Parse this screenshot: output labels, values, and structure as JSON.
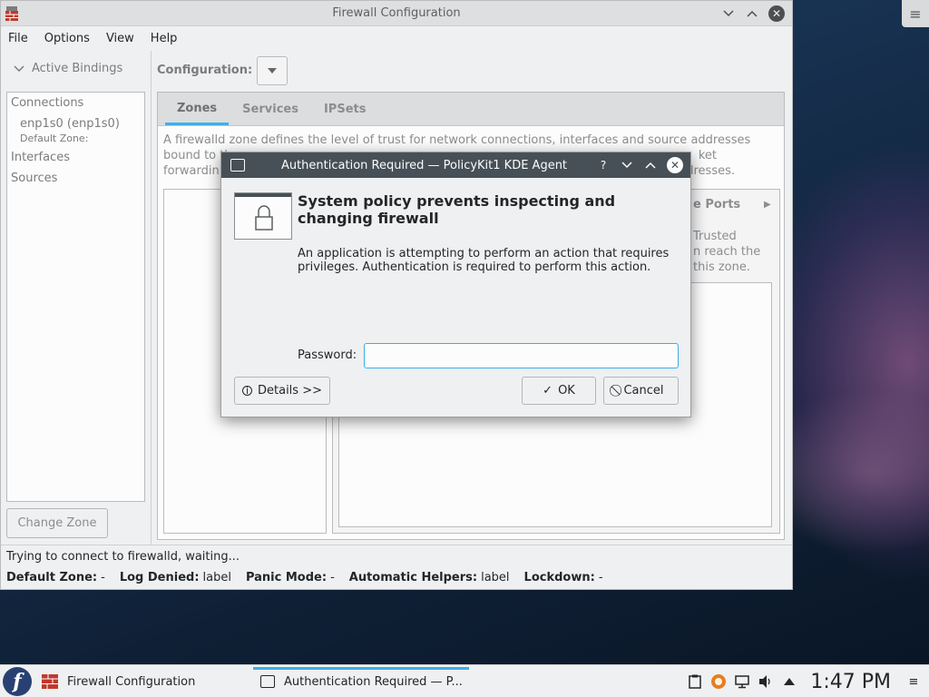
{
  "main_window": {
    "title": "Firewall Configuration",
    "menu": [
      "File",
      "Options",
      "View",
      "Help"
    ],
    "left": {
      "active_bindings": "Active Bindings",
      "connections": "Connections",
      "connection_item": "enp1s0 (enp1s0)",
      "default_zone": "Default Zone:",
      "interfaces": "Interfaces",
      "sources": "Sources",
      "change_zone": "Change Zone"
    },
    "right": {
      "configuration_label": "Configuration:",
      "tabs": [
        "Zones",
        "Services",
        "IPSets"
      ],
      "zone_desc_l1": "A firewalld zone defines the level of trust for network connections, interfaces and source addresses",
      "zone_desc_l2a": "bound to th",
      "zone_desc_l2b": "ket",
      "zone_desc_l3a": "forwardin",
      "zone_desc_l3b": "ddresses.",
      "subtab_partial": "e Ports",
      "trusted_l1": "Trusted",
      "trusted_l2": "n reach the",
      "trusted_l3": "this zone."
    },
    "status": {
      "message": "Trying to connect to firewalld, waiting...",
      "default_zone_label": "Default Zone:",
      "default_zone_value": "-",
      "log_denied_label": "Log Denied:",
      "log_denied_value": "label",
      "panic_mode_label": "Panic Mode:",
      "panic_mode_value": "-",
      "auto_helpers_label": "Automatic Helpers:",
      "auto_helpers_value": "label",
      "lockdown_label": "Lockdown:",
      "lockdown_value": "-"
    }
  },
  "dialog": {
    "title": "Authentication Required — PolicyKit1 KDE Agent",
    "help_glyph": "?",
    "heading_l1": "System policy prevents inspecting and",
    "heading_l2": "changing firewall",
    "body_l1": "An application is attempting to perform an action that requires",
    "body_l2": "privileges. Authentication is required to perform this action.",
    "password_label": "Password:",
    "password_value": "",
    "details_button": "Details >>",
    "ok_button": "OK",
    "cancel_button": "Cancel"
  },
  "taskbar": {
    "tasks": [
      "Firewall Configuration",
      "Authentication Required — P..."
    ],
    "clock": "1:47 PM",
    "launcher": "f"
  },
  "colors": {
    "accent": "#3daee9",
    "dialog_titlebar": "#475057",
    "window_bg": "#eff0f1"
  }
}
